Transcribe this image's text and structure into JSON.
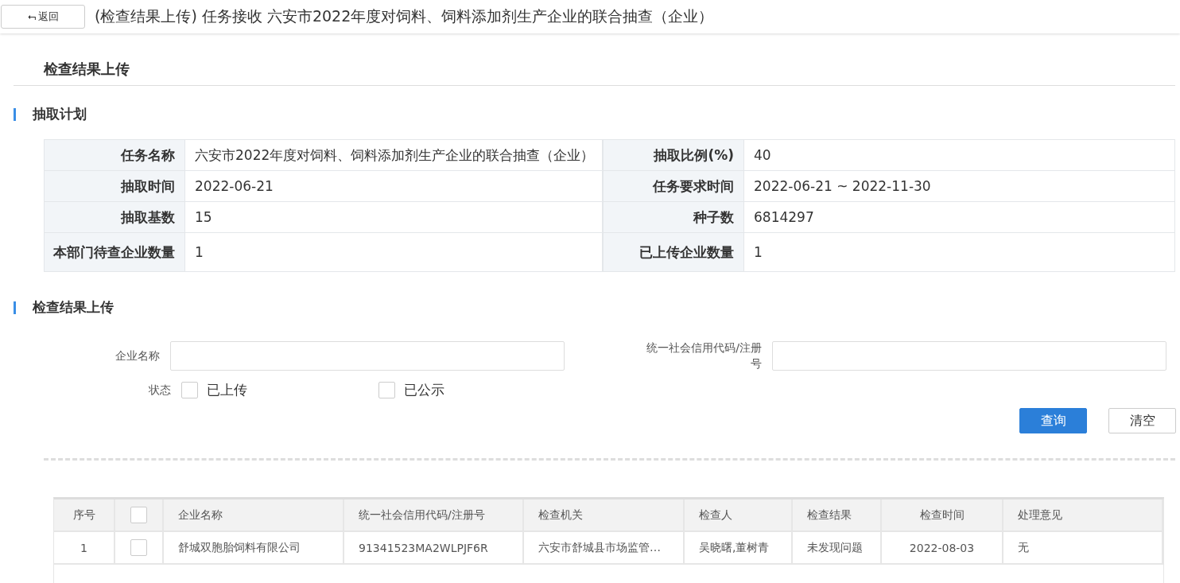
{
  "header": {
    "back_button": {
      "icon": "⮢",
      "label": "返回"
    },
    "title": "(检查结果上传) 任务接收 六安市2022年度对饲料、饲料添加剂生产企业的联合抽查（企业）"
  },
  "page_title": "检查结果上传",
  "plan": {
    "heading": "抽取计划",
    "fields": [
      {
        "label": "任务名称",
        "value": "六安市2022年度对饲料、饲料添加剂生产企业的联合抽查（企业）"
      },
      {
        "label": "抽取比例(%)",
        "value": "40"
      },
      {
        "label": "抽取时间",
        "value": "2022-06-21"
      },
      {
        "label": "任务要求时间",
        "value": "2022-06-21 ~ 2022-11-30"
      },
      {
        "label": "抽取基数",
        "value": "15"
      },
      {
        "label": "种子数",
        "value": "6814297"
      },
      {
        "label": "本部门待查企业数量",
        "value": "1"
      },
      {
        "label": "已上传企业数量",
        "value": "1"
      }
    ]
  },
  "upload": {
    "heading": "检查结果上传",
    "filters": {
      "company_name": {
        "label": "企业名称"
      },
      "credit_code": {
        "label": "统一社会信用代码/注册号"
      },
      "status": {
        "label": "状态",
        "options": [
          {
            "label": "已上传",
            "checked": false
          },
          {
            "label": "已公示",
            "checked": false
          }
        ]
      }
    },
    "buttons": [
      {
        "label": "查询",
        "kind": "primary"
      },
      {
        "label": "清空",
        "kind": "default"
      }
    ],
    "table": {
      "columns": [
        "序号",
        "企业名称",
        "统一社会信用代码/注册号",
        "检查机关",
        "检查人",
        "检查结果",
        "检查时间",
        "处理意见"
      ],
      "select_all": {
        "checked": false
      },
      "rows": [
        {
          "cells": [
            "1",
            "舒城双胞胎饲料有限公司",
            "91341523MA2WLPJF6R",
            "六安市舒城县市场监管…",
            "吴晓曙,董树青",
            "未发现问题",
            "2022-08-03",
            "无"
          ],
          "checked": false
        }
      ]
    }
  }
}
